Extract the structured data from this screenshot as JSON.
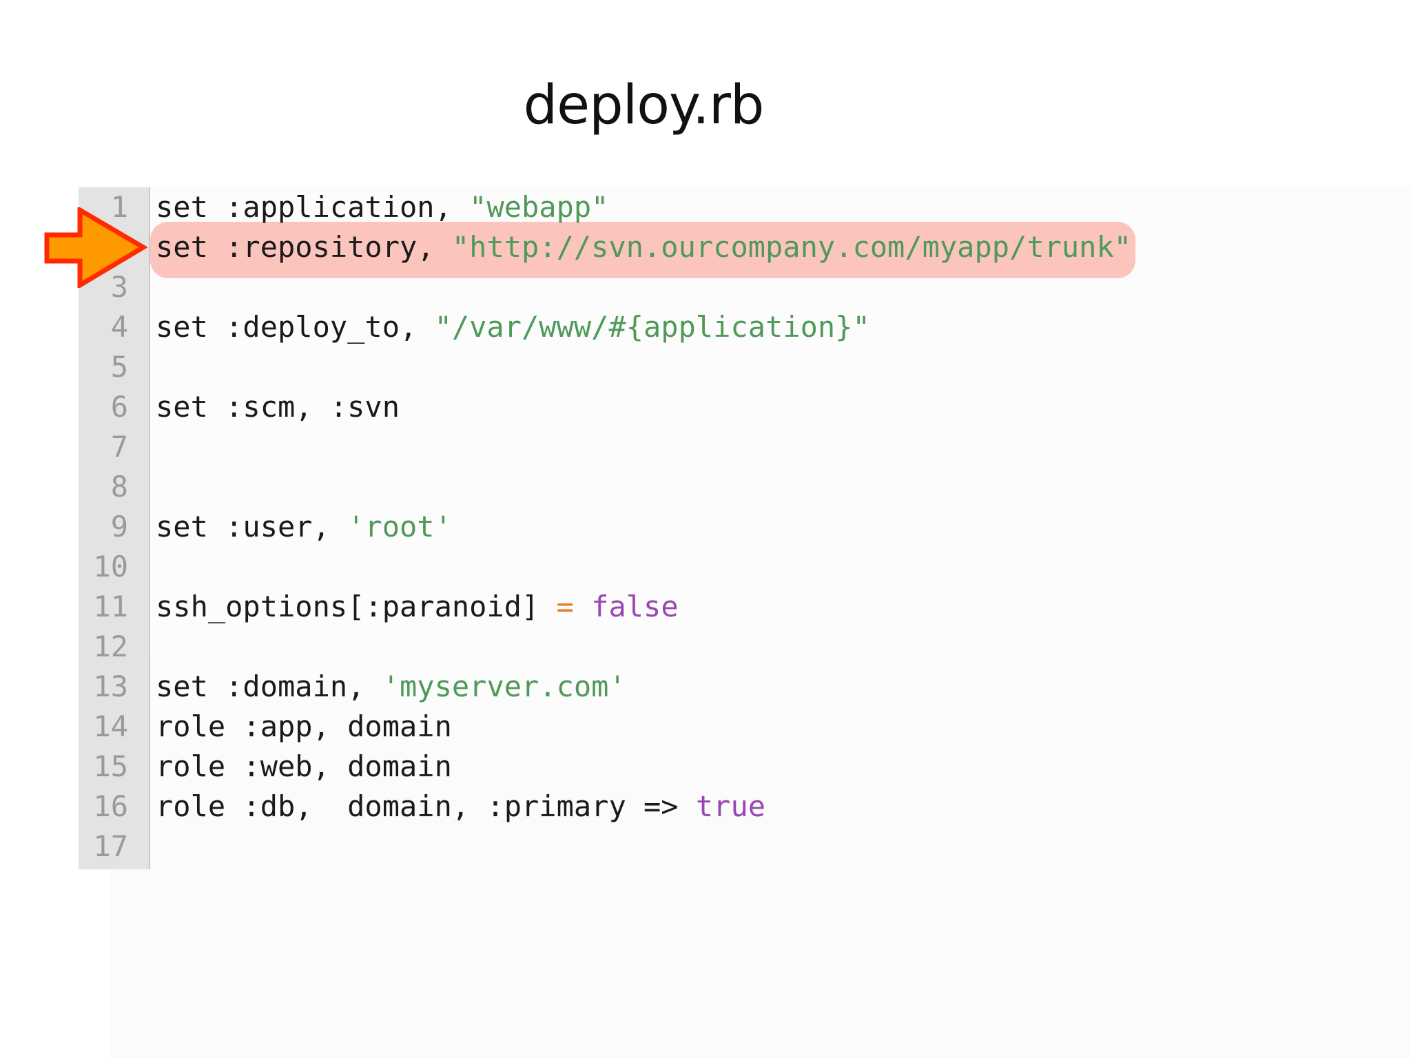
{
  "title": "deploy.rb",
  "line_numbers": [
    "1",
    "2",
    "3",
    "4",
    "5",
    "6",
    "7",
    "8",
    "9",
    "10",
    "11",
    "12",
    "13",
    "14",
    "15",
    "16",
    "17"
  ],
  "highlighted_line": 2,
  "colors": {
    "highlight": "#fbc4bd",
    "arrow_fill": "#ff9900",
    "arrow_stroke": "#ff2a00",
    "string": "#4f9a59",
    "keyword": "#9a47b3",
    "operator": "#e1822a"
  },
  "code": {
    "l1": {
      "a": "set :application, ",
      "s": "\"webapp\""
    },
    "l2": {
      "a": "set :repository, ",
      "s": "\"http://svn.ourcompany.com/myapp/trunk\""
    },
    "l4": {
      "a": "set :deploy_to, ",
      "s": "\"/var/www/#{application}\""
    },
    "l6": {
      "a": "set :scm, :svn"
    },
    "l9": {
      "a": "set :user, ",
      "s": "'root'"
    },
    "l11": {
      "a": "ssh_options[:paranoid] ",
      "op": "=",
      "k": "false"
    },
    "l13": {
      "a": "set :domain, ",
      "s": "'myserver.com'"
    },
    "l14": {
      "a": "role :app, domain"
    },
    "l15": {
      "a": "role :web, domain"
    },
    "l16": {
      "a": "role :db,  domain, :primary => ",
      "k": "true"
    }
  },
  "icons": {
    "pointer": "arrow-right-icon"
  }
}
